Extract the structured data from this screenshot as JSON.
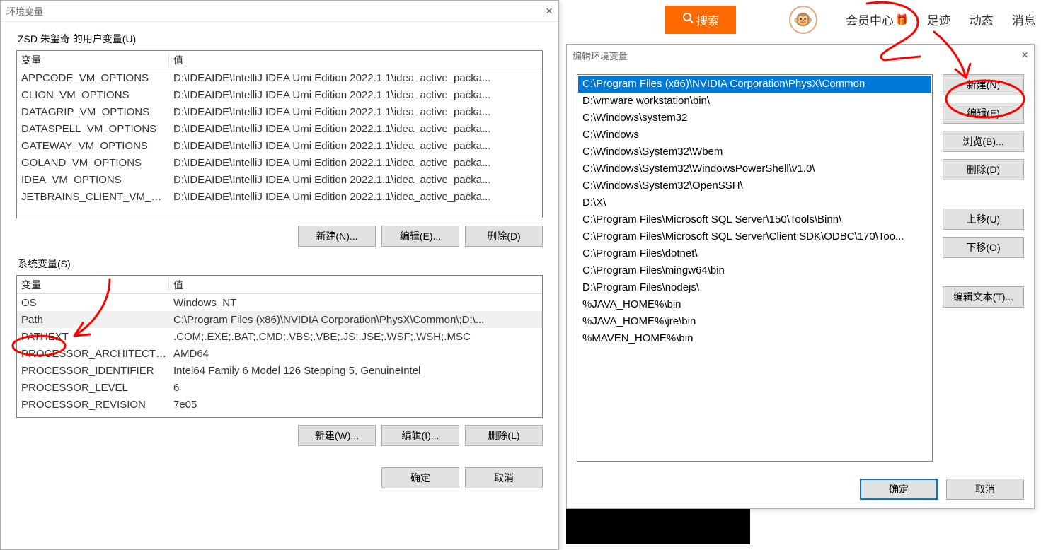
{
  "topbar": {
    "search_label": "搜索",
    "links": [
      "会员中心",
      "足迹",
      "动态",
      "消息"
    ]
  },
  "env_dialog": {
    "title": "环境变量",
    "user_section_label": "ZSD 朱玺奇 的用户变量(U)",
    "sys_section_label": "系统变量(S)",
    "col_var": "变量",
    "col_val": "值",
    "user_vars": [
      {
        "name": "APPCODE_VM_OPTIONS",
        "value": "D:\\IDEAIDE\\IntelliJ IDEA Umi Edition 2022.1.1\\idea_active_packa..."
      },
      {
        "name": "CLION_VM_OPTIONS",
        "value": "D:\\IDEAIDE\\IntelliJ IDEA Umi Edition 2022.1.1\\idea_active_packa..."
      },
      {
        "name": "DATAGRIP_VM_OPTIONS",
        "value": "D:\\IDEAIDE\\IntelliJ IDEA Umi Edition 2022.1.1\\idea_active_packa..."
      },
      {
        "name": "DATASPELL_VM_OPTIONS",
        "value": "D:\\IDEAIDE\\IntelliJ IDEA Umi Edition 2022.1.1\\idea_active_packa..."
      },
      {
        "name": "GATEWAY_VM_OPTIONS",
        "value": "D:\\IDEAIDE\\IntelliJ IDEA Umi Edition 2022.1.1\\idea_active_packa..."
      },
      {
        "name": "GOLAND_VM_OPTIONS",
        "value": "D:\\IDEAIDE\\IntelliJ IDEA Umi Edition 2022.1.1\\idea_active_packa..."
      },
      {
        "name": "IDEA_VM_OPTIONS",
        "value": "D:\\IDEAIDE\\IntelliJ IDEA Umi Edition 2022.1.1\\idea_active_packa..."
      },
      {
        "name": "JETBRAINS_CLIENT_VM_OP...",
        "value": "D:\\IDEAIDE\\IntelliJ IDEA Umi Edition 2022.1.1\\idea_active_packa..."
      }
    ],
    "sys_vars": [
      {
        "name": "OS",
        "value": "Windows_NT"
      },
      {
        "name": "Path",
        "value": "C:\\Program Files (x86)\\NVIDIA Corporation\\PhysX\\Common\\;D:\\...",
        "sel": true
      },
      {
        "name": "PATHEXT",
        "value": ".COM;.EXE;.BAT;.CMD;.VBS;.VBE;.JS;.JSE;.WSF;.WSH;.MSC"
      },
      {
        "name": "PROCESSOR_ARCHITECTURE",
        "value": "AMD64"
      },
      {
        "name": "PROCESSOR_IDENTIFIER",
        "value": "Intel64 Family 6 Model 126 Stepping 5, GenuineIntel"
      },
      {
        "name": "PROCESSOR_LEVEL",
        "value": "6"
      },
      {
        "name": "PROCESSOR_REVISION",
        "value": "7e05"
      }
    ],
    "btns": {
      "new_u": "新建(N)...",
      "edit_u": "编辑(E)...",
      "del_u": "删除(D)",
      "new_s": "新建(W)...",
      "edit_s": "编辑(I)...",
      "del_s": "删除(L)",
      "ok": "确定",
      "cancel": "取消"
    }
  },
  "edit_dialog": {
    "title": "编辑环境变量",
    "items": [
      {
        "v": "C:\\Program Files (x86)\\NVIDIA Corporation\\PhysX\\Common",
        "sel": true
      },
      {
        "v": "D:\\vmware workstation\\bin\\"
      },
      {
        "v": "C:\\Windows\\system32"
      },
      {
        "v": "C:\\Windows"
      },
      {
        "v": "C:\\Windows\\System32\\Wbem"
      },
      {
        "v": "C:\\Windows\\System32\\WindowsPowerShell\\v1.0\\"
      },
      {
        "v": "C:\\Windows\\System32\\OpenSSH\\"
      },
      {
        "v": "D:\\X\\"
      },
      {
        "v": "C:\\Program Files\\Microsoft SQL Server\\150\\Tools\\Binn\\"
      },
      {
        "v": "C:\\Program Files\\Microsoft SQL Server\\Client SDK\\ODBC\\170\\Too..."
      },
      {
        "v": "C:\\Program Files\\dotnet\\"
      },
      {
        "v": "C:\\Program Files\\mingw64\\bin"
      },
      {
        "v": "D:\\Program Files\\nodejs\\"
      },
      {
        "v": "%JAVA_HOME%\\bin"
      },
      {
        "v": "%JAVA_HOME%\\jre\\bin"
      },
      {
        "v": "%MAVEN_HOME%\\bin"
      }
    ],
    "btns": {
      "new": "新建(N)",
      "edit": "编辑(E)",
      "browse": "浏览(B)...",
      "del": "删除(D)",
      "up": "上移(U)",
      "down": "下移(O)",
      "edit_text": "编辑文本(T)...",
      "ok": "确定",
      "cancel": "取消"
    }
  }
}
